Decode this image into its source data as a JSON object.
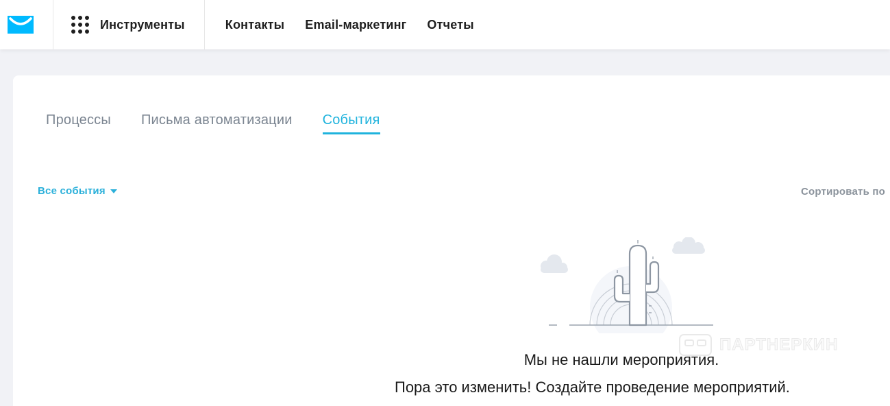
{
  "header": {
    "logo_icon": "envelope-logo-icon",
    "tools_label": "Инструменты",
    "nav": [
      "Контакты",
      "Email-маркетинг",
      "Отчеты"
    ]
  },
  "tabs": [
    {
      "label": "Процессы",
      "active": false
    },
    {
      "label": "Письма автоматизации",
      "active": false
    },
    {
      "label": "События",
      "active": true
    }
  ],
  "filter": {
    "label": "Все события"
  },
  "sort": {
    "label": "Сортировать по"
  },
  "empty": {
    "title": "Мы не нашли мероприятия.",
    "subtitle": "Пора это изменить! Создайте проведение мероприятий."
  },
  "watermark": {
    "text": "ПАРТНЕРКИН"
  },
  "colors": {
    "accent": "#1fb3dd",
    "logo": "#00baff",
    "text": "#1e1e1e",
    "muted": "#7b8591"
  }
}
